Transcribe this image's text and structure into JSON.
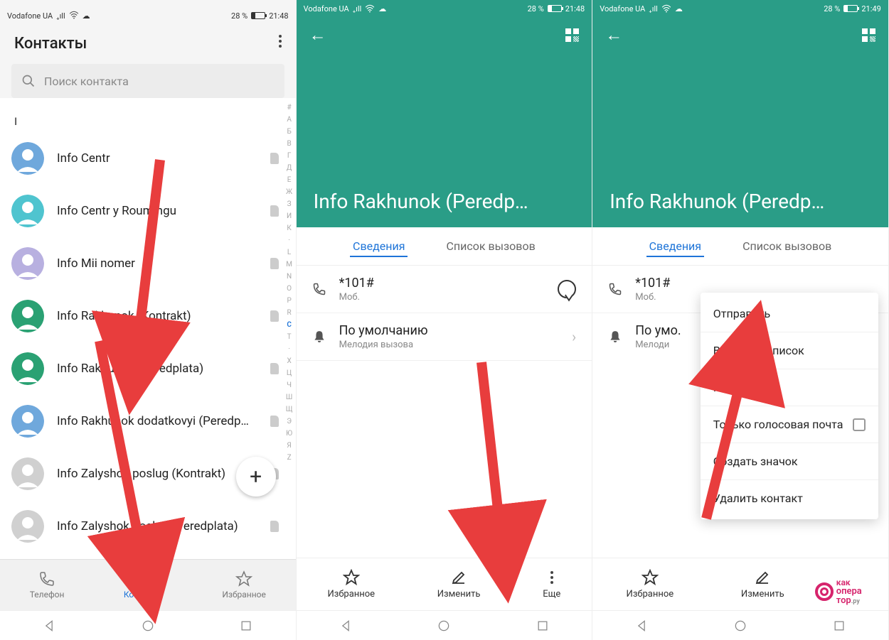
{
  "status": {
    "carrier": "Vodafone UA",
    "battery_pct": "28 %",
    "time1": "21:48",
    "time2": "21:48",
    "time3": "21:49"
  },
  "screen1": {
    "title": "Контакты",
    "search_placeholder": "Поиск контакта",
    "section_letter": "I",
    "contacts": [
      {
        "name": "Info Centr",
        "avatar_color": "#6fa8dc"
      },
      {
        "name": "Info Centr y Roumingu",
        "avatar_color": "#4fc4cf"
      },
      {
        "name": "Info Mii nomer",
        "avatar_color": "#b8b0e0"
      },
      {
        "name": "Info Rakhunok (Kontrakt)",
        "avatar_color": "#2aa173"
      },
      {
        "name": "Info Rakhunok (Peredplata)",
        "avatar_color": "#2aa173"
      },
      {
        "name": "Info Rakhunok dodatkovyi (Peredp…",
        "avatar_color": "#6fa8dc"
      },
      {
        "name": "Info Zalyshok poslug (Kontrakt)",
        "avatar_color": "#bdbdbd"
      },
      {
        "name": "Info Zalyshok poslug (Peredplata)",
        "avatar_color": "#bdbdbd"
      }
    ],
    "alpha_index": [
      "#",
      "A",
      "Б",
      "В",
      "Г",
      "Д",
      "Е",
      "Ж",
      "З",
      "И",
      "К",
      "·",
      "L",
      "M",
      "N",
      "O",
      "P",
      "R",
      "C",
      "T",
      "·",
      "X",
      "Ц",
      "Ч",
      "Ш",
      "Щ",
      "Э",
      "Ю",
      "Я",
      "Z"
    ],
    "alpha_active": "C",
    "nav": {
      "phone": "Телефон",
      "contacts": "Контакты",
      "fav": "Избранное"
    }
  },
  "screen2": {
    "contact_title": "Info Rakhunok (Peredp…",
    "tab_details": "Сведения",
    "tab_calls": "Список вызовов",
    "number": "*101#",
    "number_type": "Моб.",
    "ringtone_label": "По умолчанию",
    "ringtone_sub": "Мелодия вызова",
    "actions": {
      "fav": "Избранное",
      "edit": "Изменить",
      "more": "Еще"
    }
  },
  "screen3": {
    "contact_title": "Info Rakhunok (Peredp…",
    "tab_details": "Сведения",
    "tab_calls": "Список вызовов",
    "number": "*101#",
    "number_type": "Моб.",
    "ringtone_label": "По умол",
    "ringtone_sub": "Мелоди",
    "actions": {
      "fav": "Избранное",
      "edit": "Изменить"
    },
    "menu": {
      "send": "Отправить",
      "blacklist": "В черный список",
      "copy": "Копировать",
      "voicemail": "Только голосовая почта",
      "shortcut": "Создать значок",
      "delete": "Удалить контакт"
    }
  },
  "logo": {
    "line1": "как",
    "line2": "опера",
    "line3": "тор",
    "suffix": ".ру"
  }
}
